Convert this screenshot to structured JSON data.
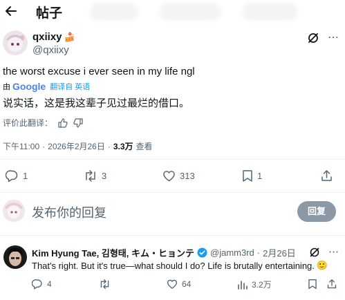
{
  "header": {
    "title": "帖子"
  },
  "post": {
    "display_name": "qxiixy",
    "badge_emoji": "🍰",
    "handle": "@qxiixy",
    "text": "the worst excuse i ever seen in my life ngl",
    "translate_by": "由",
    "translate_brand": "Google",
    "translate_label": "翻译自 英语",
    "translated_text": "说实话，这是我这辈子见过最烂的借口。",
    "rate_translation": "评价此翻译：",
    "time": "下午11:00",
    "dot1": "·",
    "date": "2026年2月26日",
    "dot2": "·",
    "views": "3.3万",
    "views_label": "查看",
    "actions": {
      "replies": "1",
      "reposts": "3",
      "likes": "313",
      "bookmarks": "1"
    }
  },
  "compose": {
    "placeholder": "发布你的回复",
    "reply_button": "回复"
  },
  "reply": {
    "display_name": "Kim Hyung Tae, 김형태, キム・ヒョンテ",
    "handle": "@jamm3rd",
    "dot": "·",
    "date": "2月26日",
    "text": "That's right. But it's true—what should I do? Life is brutally entertaining.",
    "emoji": "🙂",
    "actions": {
      "replies": "4",
      "likes": "64",
      "views": "3.2万"
    }
  },
  "colors": {
    "accent": "#1d9bf0",
    "text": "#0f1419",
    "muted": "#536471",
    "reply_button": "#8b98a5"
  }
}
